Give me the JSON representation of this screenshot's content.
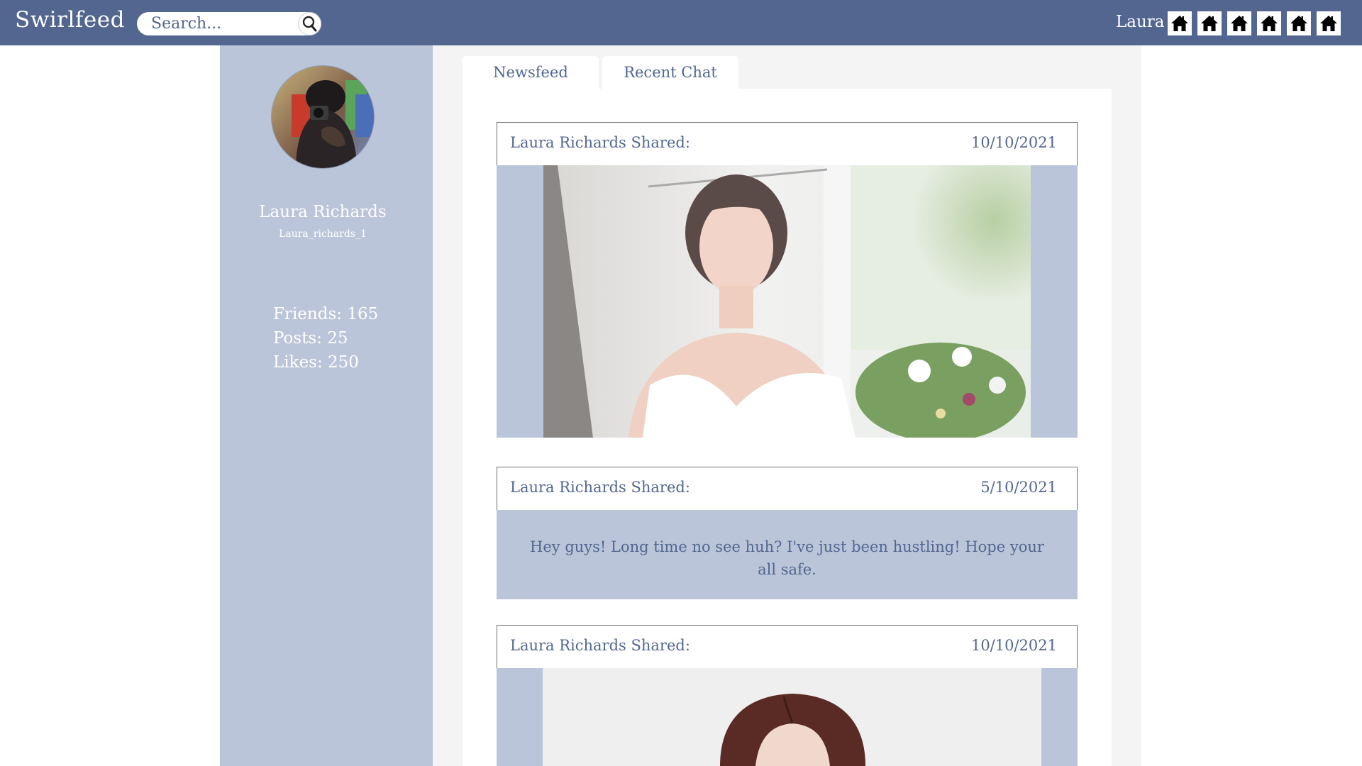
{
  "app": {
    "brand": "Swirlfeed",
    "search_placeholder": "Search...",
    "user_name": "Laura",
    "nav_icons": [
      "home-icon",
      "home-icon",
      "home-icon",
      "home-icon",
      "home-icon",
      "home-icon"
    ]
  },
  "profile": {
    "name": "Laura Richards",
    "handle": "Laura_richards_1",
    "friends": "Friends: 165",
    "posts": "Posts: 25",
    "likes": "Likes: 250"
  },
  "tabs": [
    {
      "label": "Newsfeed"
    },
    {
      "label": "Recent Chat"
    }
  ],
  "posts": [
    {
      "author": "Laura Richards Shared:",
      "date": "10/10/2021",
      "type": "image"
    },
    {
      "author": "Laura Richards Shared:",
      "date": "5/10/2021",
      "type": "text",
      "text": "Hey guys! Long time no see huh? I've just been hustling! Hope your all safe."
    },
    {
      "author": "Laura Richards Shared:",
      "date": "10/10/2021",
      "type": "image"
    }
  ],
  "colors": {
    "topbar": "#526690",
    "sidebar": "#bbc5d9",
    "text_accent": "#526690",
    "main_bg": "#f4f4f4"
  }
}
